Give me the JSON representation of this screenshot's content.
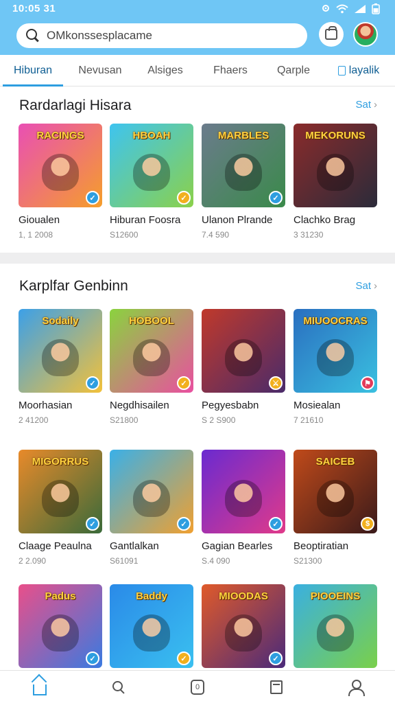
{
  "status": {
    "time": "10:05 31"
  },
  "search": {
    "placeholder": "OMkonssesplacame"
  },
  "tabs": [
    {
      "label": "Hiburan",
      "active": true
    },
    {
      "label": "Nevusan",
      "active": false
    },
    {
      "label": "Alsiges",
      "active": false
    },
    {
      "label": "Fhaers",
      "active": false
    },
    {
      "label": "Qarple",
      "active": false
    },
    {
      "label": "layalik",
      "active": false
    }
  ],
  "section1": {
    "title": "Rardarlagi Hisara",
    "see_all": "Sat",
    "items": [
      {
        "name": "Gioualen",
        "meta": "1,  1 2008",
        "logo": "RACINGS",
        "bg": [
          "#e94fb4",
          "#f59e2b"
        ],
        "badge": "✓",
        "badge_color": "#2e9ee0"
      },
      {
        "name": "Hiburan Foosra",
        "meta": "S12600",
        "logo": "HBOAH",
        "bg": [
          "#3ec4f0",
          "#8bd14a"
        ],
        "badge": "✓",
        "badge_color": "#f2b01e"
      },
      {
        "name": "Ulanon Plrande",
        "meta": "7.4 590",
        "logo": "MARBLES",
        "bg": [
          "#6b7b8c",
          "#3a8a4a"
        ],
        "badge": "✓",
        "badge_color": "#2e9ee0"
      },
      {
        "name": "Clachko Brag",
        "meta": "3 31230",
        "logo": "MEKORUNS",
        "bg": [
          "#8a2b2b",
          "#2b2b3a"
        ],
        "badge": "",
        "badge_color": ""
      }
    ]
  },
  "section2": {
    "title": "Karplfar Genbinn",
    "see_all": "Sat",
    "items": [
      {
        "name": "Moorhasian",
        "meta": "2 41200",
        "logo": "Sodaily",
        "bg": [
          "#3ca0e8",
          "#f3c13a"
        ],
        "badge": "✓",
        "badge_color": "#2e9ee0"
      },
      {
        "name": "Negdhisailen",
        "meta": "S21800",
        "logo": "HOBOOL",
        "bg": [
          "#8ad33e",
          "#e94fa0"
        ],
        "badge": "✓",
        "badge_color": "#f2b01e"
      },
      {
        "name": "Pegyesbabn",
        "meta": "S 2 S900",
        "logo": "",
        "bg": [
          "#c0392b",
          "#4a2b6a"
        ],
        "badge": "⚔",
        "badge_color": "#f2b01e"
      },
      {
        "name": "Mosiealan",
        "meta": "7 21610",
        "logo": "MIUOOCRAS",
        "bg": [
          "#2a6fc0",
          "#3ac0e0"
        ],
        "badge": "⚑",
        "badge_color": "#e23b5a"
      },
      {
        "name": "Claage Peaulna",
        "meta": "2 2.090",
        "logo": "MIGORRUS",
        "bg": [
          "#e88a2a",
          "#3a6a3a"
        ],
        "badge": "✓",
        "badge_color": "#2e9ee0"
      },
      {
        "name": "Gantlalkan",
        "meta": "S61091",
        "logo": "",
        "bg": [
          "#3ab0e8",
          "#f0a030"
        ],
        "badge": "✓",
        "badge_color": "#2e9ee0"
      },
      {
        "name": "Gagian Bearles",
        "meta": "S.4 090",
        "logo": "",
        "bg": [
          "#6a2ad0",
          "#e03a8a"
        ],
        "badge": "✓",
        "badge_color": "#2e9ee0"
      },
      {
        "name": "Beoptiratian",
        "meta": "S21300",
        "logo": "SAICEB",
        "bg": [
          "#c04a1a",
          "#3a1a1a"
        ],
        "badge": "$",
        "badge_color": "#f2b01e"
      },
      {
        "name": "",
        "meta": "",
        "logo": "Padus",
        "bg": [
          "#e94f8a",
          "#3a7ae0"
        ],
        "badge": "✓",
        "badge_color": "#2e9ee0"
      },
      {
        "name": "",
        "meta": "",
        "logo": "Baddy",
        "bg": [
          "#2a8ae8",
          "#3ac0f0"
        ],
        "badge": "✓",
        "badge_color": "#f2b01e"
      },
      {
        "name": "",
        "meta": "",
        "logo": "MIOODAS",
        "bg": [
          "#e05a2a",
          "#4a2a7a"
        ],
        "badge": "✓",
        "badge_color": "#2e9ee0"
      },
      {
        "name": "",
        "meta": "",
        "logo": "PIOOEINS",
        "bg": [
          "#3ab0e0",
          "#7ad04a"
        ],
        "badge": "",
        "badge_color": ""
      }
    ]
  },
  "colors": {
    "accent": "#2e9ee0",
    "header": "#6fc6f5"
  },
  "icons": [
    "search-icon",
    "bag-icon",
    "avatar",
    "home-icon",
    "search-nav-icon",
    "game-icon",
    "library-icon",
    "profile-icon"
  ]
}
